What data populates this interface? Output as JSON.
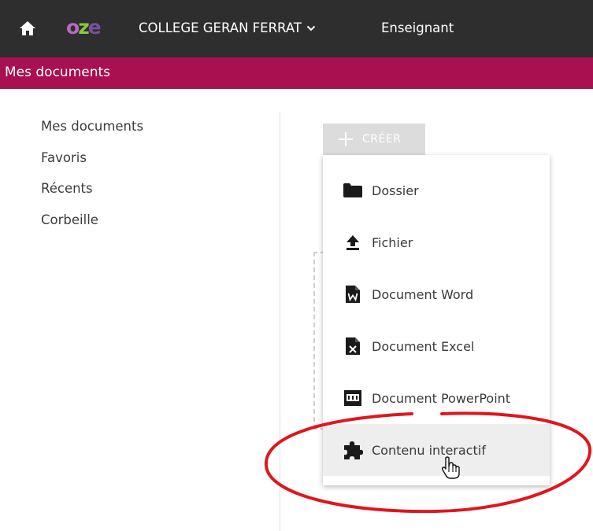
{
  "header": {
    "home_icon": "home-icon",
    "logo": {
      "o": "o",
      "z": "z",
      "e": "e"
    },
    "school": "COLLEGE GERAN FERRAT",
    "role": "Enseignant"
  },
  "subheader": {
    "title": "Mes documents"
  },
  "sidebar": {
    "items": [
      {
        "label": "Mes documents"
      },
      {
        "label": "Favoris"
      },
      {
        "label": "Récents"
      },
      {
        "label": "Corbeille"
      }
    ]
  },
  "toolbar": {
    "create_label": "CRÉER"
  },
  "create_menu": {
    "items": [
      {
        "label": "Dossier",
        "icon": "folder-icon"
      },
      {
        "label": "Fichier",
        "icon": "upload-icon"
      },
      {
        "label": "Document Word",
        "icon": "word-document-icon"
      },
      {
        "label": "Document Excel",
        "icon": "excel-document-icon"
      },
      {
        "label": "Document PowerPoint",
        "icon": "powerpoint-document-icon"
      },
      {
        "label": "Contenu interactif",
        "icon": "puzzle-icon"
      }
    ]
  },
  "colors": {
    "topbar": "#2e2e2e",
    "subbar": "#a8104f",
    "annotation": "#e0161d"
  }
}
